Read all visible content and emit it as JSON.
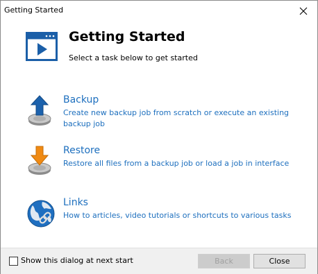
{
  "window": {
    "title": "Getting Started"
  },
  "header": {
    "title": "Getting Started",
    "subtitle": "Select a task below to get started",
    "icon": "window-play-icon"
  },
  "tasks": [
    {
      "title": "Backup",
      "description": "Create new backup job from scratch or execute an existing backup job",
      "icon": "upload-arrow-disk-icon"
    },
    {
      "title": "Restore",
      "description": "Restore all files from a backup job or load a job in interface",
      "icon": "download-arrow-disk-icon"
    },
    {
      "title": "Links",
      "description": "How to articles, video tutorials or shortcuts to various tasks",
      "icon": "globe-link-icon"
    }
  ],
  "footer": {
    "checkbox_label": "Show this dialog at next start",
    "checkbox_checked": false,
    "back_label": "Back",
    "back_enabled": false,
    "close_label": "Close"
  },
  "colors": {
    "link": "#1d6fbe",
    "header_icon": "#1b5fa8",
    "backup_arrow": "#1c62ad",
    "restore_arrow": "#f08a13"
  }
}
